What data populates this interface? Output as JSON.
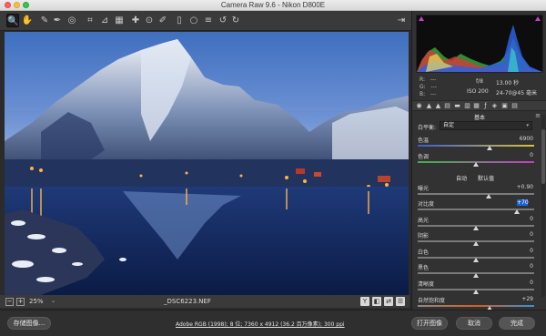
{
  "window": {
    "title": "Camera Raw 9.6  -  Nikon D800E"
  },
  "toolbar": {
    "tools": [
      {
        "name": "zoom-tool-icon",
        "glyph": "🔍"
      },
      {
        "name": "hand-tool-icon",
        "glyph": "✋"
      },
      {
        "name": "white-balance-tool-icon",
        "glyph": "✎"
      },
      {
        "name": "color-sampler-tool-icon",
        "glyph": "✒"
      },
      {
        "name": "targeted-adjustment-tool-icon",
        "glyph": "◎"
      },
      {
        "name": "crop-tool-icon",
        "glyph": "⌗"
      },
      {
        "name": "straighten-tool-icon",
        "glyph": "⊿"
      },
      {
        "name": "transform-tool-icon",
        "glyph": "▦"
      },
      {
        "name": "spot-removal-tool-icon",
        "glyph": "✚"
      },
      {
        "name": "red-eye-tool-icon",
        "glyph": "⊙"
      },
      {
        "name": "adjustment-brush-icon",
        "glyph": "✐"
      },
      {
        "name": "graduated-filter-icon",
        "glyph": "▯"
      },
      {
        "name": "radial-filter-icon",
        "glyph": "○"
      },
      {
        "name": "preferences-icon",
        "glyph": "≡"
      },
      {
        "name": "rotate-left-icon",
        "glyph": "↺"
      },
      {
        "name": "rotate-right-icon",
        "glyph": "↻"
      }
    ]
  },
  "statusbar": {
    "zoom": "25%",
    "filename": "_DSC6223.NEF",
    "view_buttons": [
      "Y",
      "◧",
      "⇄",
      "☰"
    ]
  },
  "bottombar": {
    "save_label": "存储图像...",
    "workflow": "Adobe RGB (1998); 8 位; 7360 x 4912 (36.2 百万像素); 300 ppi",
    "open_label": "打开图像",
    "cancel_label": "取消",
    "done_label": "完成"
  },
  "info": {
    "r_label": "R:",
    "g_label": "G:",
    "b_label": "B:",
    "r_value": "---",
    "g_value": "---",
    "b_value": "---",
    "aperture": "f/8",
    "shutter": "13.00 秒",
    "iso": "ISO 200",
    "lens": "24-70@45 毫米"
  },
  "panel": {
    "section_title": "基本",
    "wb_label": "白平衡:",
    "wb_value": "自定",
    "auto_label": "自动",
    "default_label": "默认值",
    "sliders": [
      {
        "label": "色温",
        "value": "6900",
        "pos": 0.62,
        "gradient": "linear-gradient(90deg,#3b5bd6,#d8c43a)"
      },
      {
        "label": "色调",
        "value": "0",
        "pos": 0.5,
        "gradient": "linear-gradient(90deg,#3fb24a,#c13fc1)"
      },
      {
        "label": "曝光",
        "value": "+0.90",
        "pos": 0.61,
        "gradient": "#7a7a7a"
      },
      {
        "label": "对比度",
        "value": "+70",
        "pos": 0.85,
        "gradient": "#7a7a7a",
        "highlight": true
      },
      {
        "label": "高光",
        "value": "0",
        "pos": 0.5,
        "gradient": "#7a7a7a"
      },
      {
        "label": "阴影",
        "value": "0",
        "pos": 0.5,
        "gradient": "#7a7a7a"
      },
      {
        "label": "白色",
        "value": "0",
        "pos": 0.5,
        "gradient": "#7a7a7a"
      },
      {
        "label": "黑色",
        "value": "0",
        "pos": 0.5,
        "gradient": "#7a7a7a"
      },
      {
        "label": "清晰度",
        "value": "0",
        "pos": 0.5,
        "gradient": "#7a7a7a"
      },
      {
        "label": "自然饱和度",
        "value": "+29",
        "pos": 0.62,
        "gradient": "linear-gradient(90deg,#8a8a8a,#d06020,#3a8fd6)"
      }
    ]
  },
  "colors": {
    "accent": "#1f62d6",
    "clip_warning": "#c93ec9"
  }
}
